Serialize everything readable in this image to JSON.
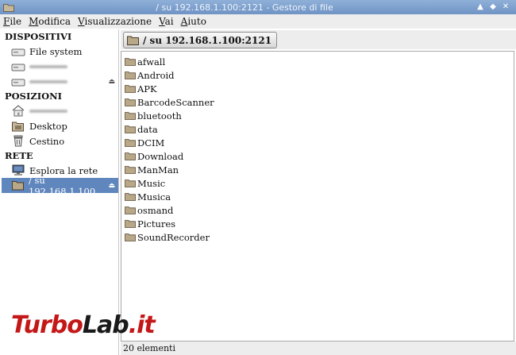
{
  "window": {
    "title": "/ su 192.168.1.100:2121 - Gestore di file",
    "buttons": [
      "▲",
      "◆",
      "✕"
    ]
  },
  "menu": [
    "File",
    "Modifica",
    "Visualizzazione",
    "Vai",
    "Aiuto"
  ],
  "sidebar": {
    "devices_heading": "DISPOSITIVI",
    "devices": [
      {
        "label": "File system",
        "icon": "drive-icon"
      },
      {
        "label": "",
        "icon": "drive-icon"
      },
      {
        "label": "",
        "icon": "drive-icon",
        "eject": "⏏"
      }
    ],
    "places_heading": "POSIZIONI",
    "places": [
      {
        "label": "",
        "icon": "home-icon"
      },
      {
        "label": "Desktop",
        "icon": "desktop-icon"
      },
      {
        "label": "Cestino",
        "icon": "trash-icon"
      }
    ],
    "network_heading": "RETE",
    "network": [
      {
        "label": "Esplora la rete",
        "icon": "network-icon"
      },
      {
        "label": "/ su 192.168.1.100...",
        "icon": "folder-icon",
        "eject": "⏏",
        "selected": true
      }
    ]
  },
  "location": {
    "label": "/ su 192.168.1.100:2121"
  },
  "files": [
    "afwall",
    "Android",
    "APK",
    "BarcodeScanner",
    "bluetooth",
    "data",
    "DCIM",
    "Download",
    "ManMan",
    "Music",
    "Musica",
    "osmand",
    "Pictures",
    "SoundRecorder"
  ],
  "status": {
    "text": "20 elementi"
  },
  "watermark": {
    "part1": "Turbo",
    "part2": "Lab",
    "part3": ".it"
  },
  "colors": {
    "titlebar": "#7a9cc9",
    "selection": "#5f86bd",
    "folder": "#a08a6a"
  }
}
